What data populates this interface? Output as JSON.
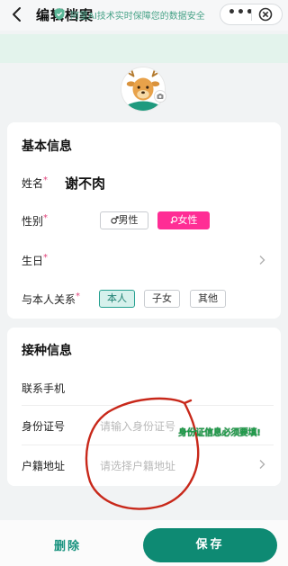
{
  "nav": {
    "title": "编辑档案",
    "more_icon": "more-dots-icon",
    "close_icon": "close-circle-icon",
    "dots": "•••"
  },
  "banner": {
    "text": "阿里AI技术实时保障您的数据安全",
    "icon": "shield-check-icon"
  },
  "basic": {
    "title": "基本信息",
    "name_label": "姓名",
    "name_value": "谢不肉",
    "gender_label": "性别",
    "gender_options": [
      "男性",
      "女性"
    ],
    "gender_selected": "女性",
    "birthday_label": "生日",
    "relation_label": "与本人关系",
    "relation_options": [
      "本人",
      "子女",
      "其他"
    ],
    "relation_selected": "本人",
    "required_mark": "*"
  },
  "vaccine": {
    "title": "接种信息",
    "phone_label": "联系手机",
    "id_label": "身份证号",
    "id_placeholder": "请输入身份证号",
    "address_label": "户籍地址",
    "address_placeholder": "请选择户籍地址"
  },
  "footer": {
    "delete_label": "删除",
    "save_label": "保存"
  },
  "annotation": {
    "text": "身份证信息必须要填!",
    "circle_color": "#c8281a",
    "text_color": "#1e9d4a"
  },
  "colors": {
    "primary": "#0e8a73",
    "pink": "#ff2d95",
    "banner_bg": "#e3f3ec"
  }
}
